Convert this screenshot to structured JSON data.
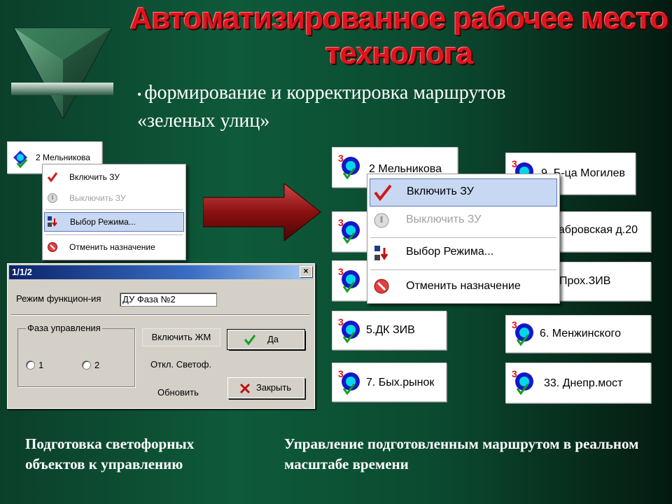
{
  "slide": {
    "title": "Автоматизированное рабочее место технолога",
    "bullet": "•",
    "subtitle": "формирование и корректировка маршрутов «зеленых улиц»"
  },
  "left_panel": {
    "item_label": "2 Мельникова",
    "menu": {
      "enable": "Включить ЗУ",
      "disable": "Выключить ЗУ",
      "mode": "Выбор Режима...",
      "cancel": "Отменить назначение"
    }
  },
  "dialog": {
    "title": "1/1/2",
    "mode_label": "Режим функцион-ия",
    "mode_value": "ДУ Фаза №2",
    "group_title": "Фаза управления",
    "radio_1": "1",
    "radio_2": "2",
    "btn_enable_jm": "Включить ЖМ",
    "btn_off_lights": "Откл. Светоф.",
    "btn_refresh": "Обновить",
    "btn_ok": "Да",
    "btn_close": "Закрыть"
  },
  "right_panel": {
    "items": [
      "2 Мельникова",
      "9. Б-ца Могилев",
      "аабровская д.20",
      "Прох.ЗИВ",
      "5.ДК ЗИВ",
      "6. Менжинского",
      "7. Бых.рынок",
      "33. Днепр.мост"
    ],
    "menu": {
      "enable": "Включить ЗУ",
      "disable": "Выключить ЗУ",
      "mode": "Выбор Режима...",
      "cancel": "Отменить назначение"
    }
  },
  "captions": {
    "left": "Подготовка светофорных объектов к управлению",
    "right": "Управление подготовленным маршрутом в реальном масштабе времени"
  },
  "colors": {
    "title": "#e0141e",
    "background": "#0e5a3a",
    "highlight": "#c8d8f2"
  }
}
